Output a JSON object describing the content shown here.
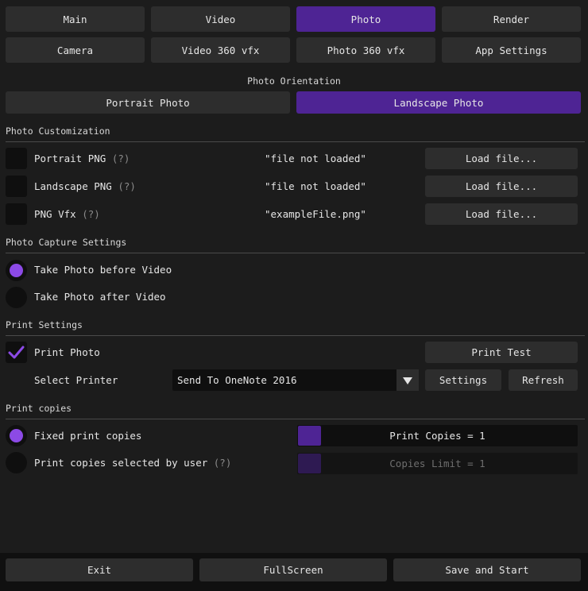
{
  "tabs": [
    {
      "label": "Main"
    },
    {
      "label": "Video"
    },
    {
      "label": "Photo"
    },
    {
      "label": "Render"
    },
    {
      "label": "Camera"
    },
    {
      "label": "Video 360 vfx"
    },
    {
      "label": "Photo 360 vfx"
    },
    {
      "label": "App Settings"
    }
  ],
  "active_tab": "Photo",
  "orientation": {
    "heading": "Photo Orientation",
    "portrait": "Portrait Photo",
    "landscape": "Landscape Photo",
    "selected": "Landscape Photo"
  },
  "customization": {
    "heading": "Photo Customization",
    "rows": [
      {
        "label": "Portrait PNG",
        "help": "(?)",
        "file": "\"file not loaded\"",
        "button": "Load file..."
      },
      {
        "label": "Landscape PNG",
        "help": "(?)",
        "file": "\"file not loaded\"",
        "button": "Load file..."
      },
      {
        "label": "PNG Vfx",
        "help": "(?)",
        "file": "\"exampleFile.png\"",
        "button": "Load file..."
      }
    ]
  },
  "capture": {
    "heading": "Photo Capture Settings",
    "before": "Take Photo before Video",
    "after": "Take Photo after Video",
    "selected": "before"
  },
  "print": {
    "heading": "Print Settings",
    "print_photo": "Print Photo",
    "print_photo_checked": true,
    "print_test": "Print Test",
    "select_printer": "Select Printer",
    "printer_value": "Send To OneNote 2016",
    "settings": "Settings",
    "refresh": "Refresh"
  },
  "copies": {
    "heading": "Print copies",
    "fixed": "Fixed print copies",
    "by_user": "Print copies selected by user",
    "by_user_help": "(?)",
    "print_copies_text": "Print Copies = 1",
    "print_copies_value": 1,
    "limit_text": "Copies Limit = 1",
    "limit_value": 1,
    "selected": "fixed"
  },
  "footer": {
    "exit": "Exit",
    "fullscreen": "FullScreen",
    "save_start": "Save and Start"
  },
  "colors": {
    "accent": "#8c4ae6",
    "active": "#4e2494",
    "bg": "#1c1c1c"
  }
}
